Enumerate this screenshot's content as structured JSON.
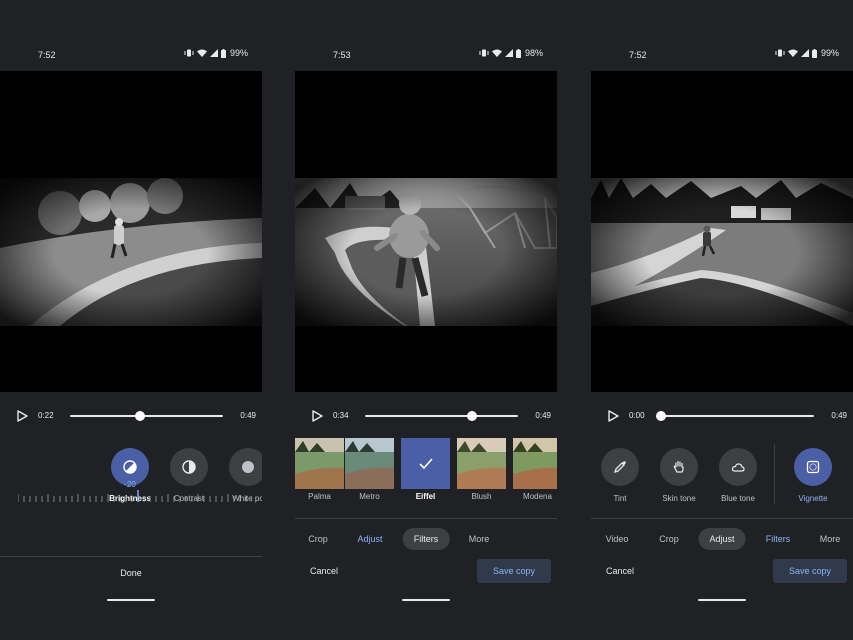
{
  "screens": [
    {
      "status": {
        "time": "7:52",
        "battery": "99%"
      },
      "player": {
        "current": "0:22",
        "end": "0:49",
        "progress": 0.46
      },
      "tools": [
        {
          "label": "Brightness",
          "icon": "brightness-icon",
          "active": true
        },
        {
          "label": "Contrast",
          "icon": "contrast-icon",
          "active": false
        },
        {
          "label": "White po",
          "icon": "white-point-icon",
          "active": false
        }
      ],
      "ruler": {
        "value": "-20"
      },
      "done_label": "Done"
    },
    {
      "status": {
        "time": "7:53",
        "battery": "98%"
      },
      "player": {
        "current": "0:34",
        "end": "0:49",
        "progress": 0.7
      },
      "filters": [
        {
          "label": "Palma",
          "selected": false
        },
        {
          "label": "Metro",
          "selected": false
        },
        {
          "label": "Eiffel",
          "selected": true
        },
        {
          "label": "Blush",
          "selected": false
        },
        {
          "label": "Modena",
          "selected": false
        }
      ],
      "tabs": [
        {
          "label": "Crop"
        },
        {
          "label": "Adjust"
        },
        {
          "label": "Filters"
        },
        {
          "label": "More"
        }
      ],
      "cancel_label": "Cancel",
      "save_label": "Save copy"
    },
    {
      "status": {
        "time": "7:52",
        "battery": "99%"
      },
      "player": {
        "current": "0:00",
        "end": "0:49",
        "progress": 0.0
      },
      "tools": [
        {
          "label": "Tint",
          "icon": "eyedropper-icon",
          "active": false
        },
        {
          "label": "Skin tone",
          "icon": "hand-icon",
          "active": false
        },
        {
          "label": "Blue tone",
          "icon": "cloud-icon",
          "active": false
        },
        {
          "label": "Vignette",
          "icon": "vignette-icon",
          "active": true
        }
      ],
      "tabs": [
        {
          "label": "Video"
        },
        {
          "label": "Crop"
        },
        {
          "label": "Adjust"
        },
        {
          "label": "Filters"
        },
        {
          "label": "More"
        }
      ],
      "cancel_label": "Cancel",
      "save_label": "Save copy"
    }
  ],
  "colors": {
    "accent": "#8ab4f8",
    "active_tool": "#4a5fa6",
    "panel": "#202124"
  }
}
